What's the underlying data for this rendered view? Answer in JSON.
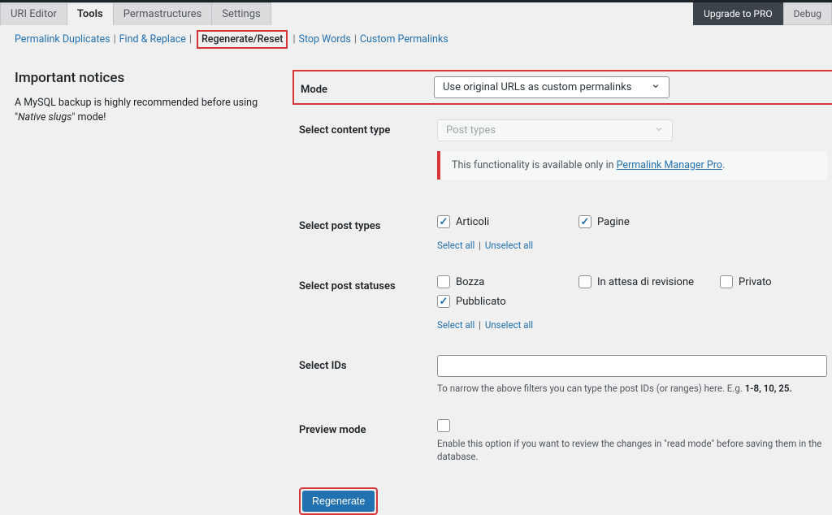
{
  "tabs": {
    "uri_editor": "URI Editor",
    "tools": "Tools",
    "permastructures": "Permastructures",
    "settings": "Settings",
    "upgrade": "Upgrade to PRO",
    "debug": "Debug"
  },
  "subnav": {
    "duplicates": "Permalink Duplicates",
    "find_replace": "Find & Replace",
    "regenerate": "Regenerate/Reset",
    "stop_words": "Stop Words",
    "custom_permalinks": "Custom Permalinks"
  },
  "notices": {
    "title": "Important notices",
    "mysql_pre": "A MySQL backup is highly recommended before using \"",
    "mysql_em": "Native slugs",
    "mysql_post": "\" mode!"
  },
  "form": {
    "mode_label": "Mode",
    "mode_value": "Use original URLs as custom permalinks",
    "content_type_label": "Select content type",
    "content_type_value": "Post types",
    "pro_notice_pre": "This functionality is available only in ",
    "pro_notice_link": "Permalink Manager Pro",
    "pro_notice_post": ".",
    "post_types_label": "Select post types",
    "post_types": {
      "articoli": "Articoli",
      "pagine": "Pagine"
    },
    "post_statuses_label": "Select post statuses",
    "post_statuses": {
      "bozza": "Bozza",
      "in_attesa": "In attesa di revisione",
      "privato": "Privato",
      "pubblicato": "Pubblicato"
    },
    "select_all": "Select all",
    "unselect_all": "Unselect all",
    "ids_label": "Select IDs",
    "ids_desc_pre": "To narrow the above filters you can type the post IDs (or ranges) here. E.g. ",
    "ids_desc_strong": "1-8, 10, 25.",
    "preview_label": "Preview mode",
    "preview_desc": "Enable this option if you want to review the changes in \"read mode\" before saving them in the database.",
    "submit": "Regenerate"
  }
}
